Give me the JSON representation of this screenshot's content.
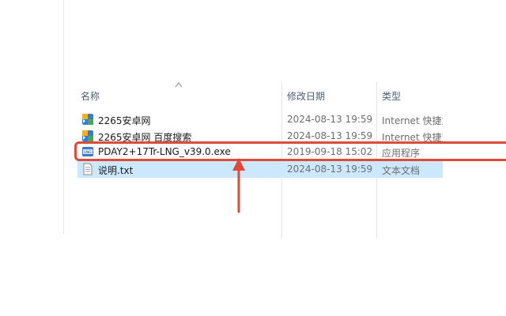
{
  "columns": {
    "name": "名称",
    "date": "修改日期",
    "type": "类型"
  },
  "files": [
    {
      "name": "2265安卓网",
      "date": "2024-08-13 19:59",
      "type": "Internet 快捷方式",
      "icon": "internet-shortcut-icon",
      "selected": false
    },
    {
      "name": "2265安卓网 百度搜索",
      "date": "2024-08-13 19:59",
      "type": "Internet 快捷方式",
      "icon": "internet-shortcut-icon",
      "selected": false
    },
    {
      "name": "PDAY2+17Tr-LNG_v39.0.exe",
      "date": "2019-09-18 15:02",
      "type": "应用程序",
      "icon": "lng-exe-icon",
      "selected": false
    },
    {
      "name": "说明.txt",
      "date": "2024-08-13 19:59",
      "type": "文本文档",
      "icon": "text-file-icon",
      "selected": true
    }
  ],
  "colors": {
    "header_text": "#4c607a",
    "selection": "#cce8ff",
    "annotation_red": "#e04a3a"
  },
  "annotation": {
    "highlighted_file": "PDAY2+17Tr-LNG_v39.0.exe"
  }
}
